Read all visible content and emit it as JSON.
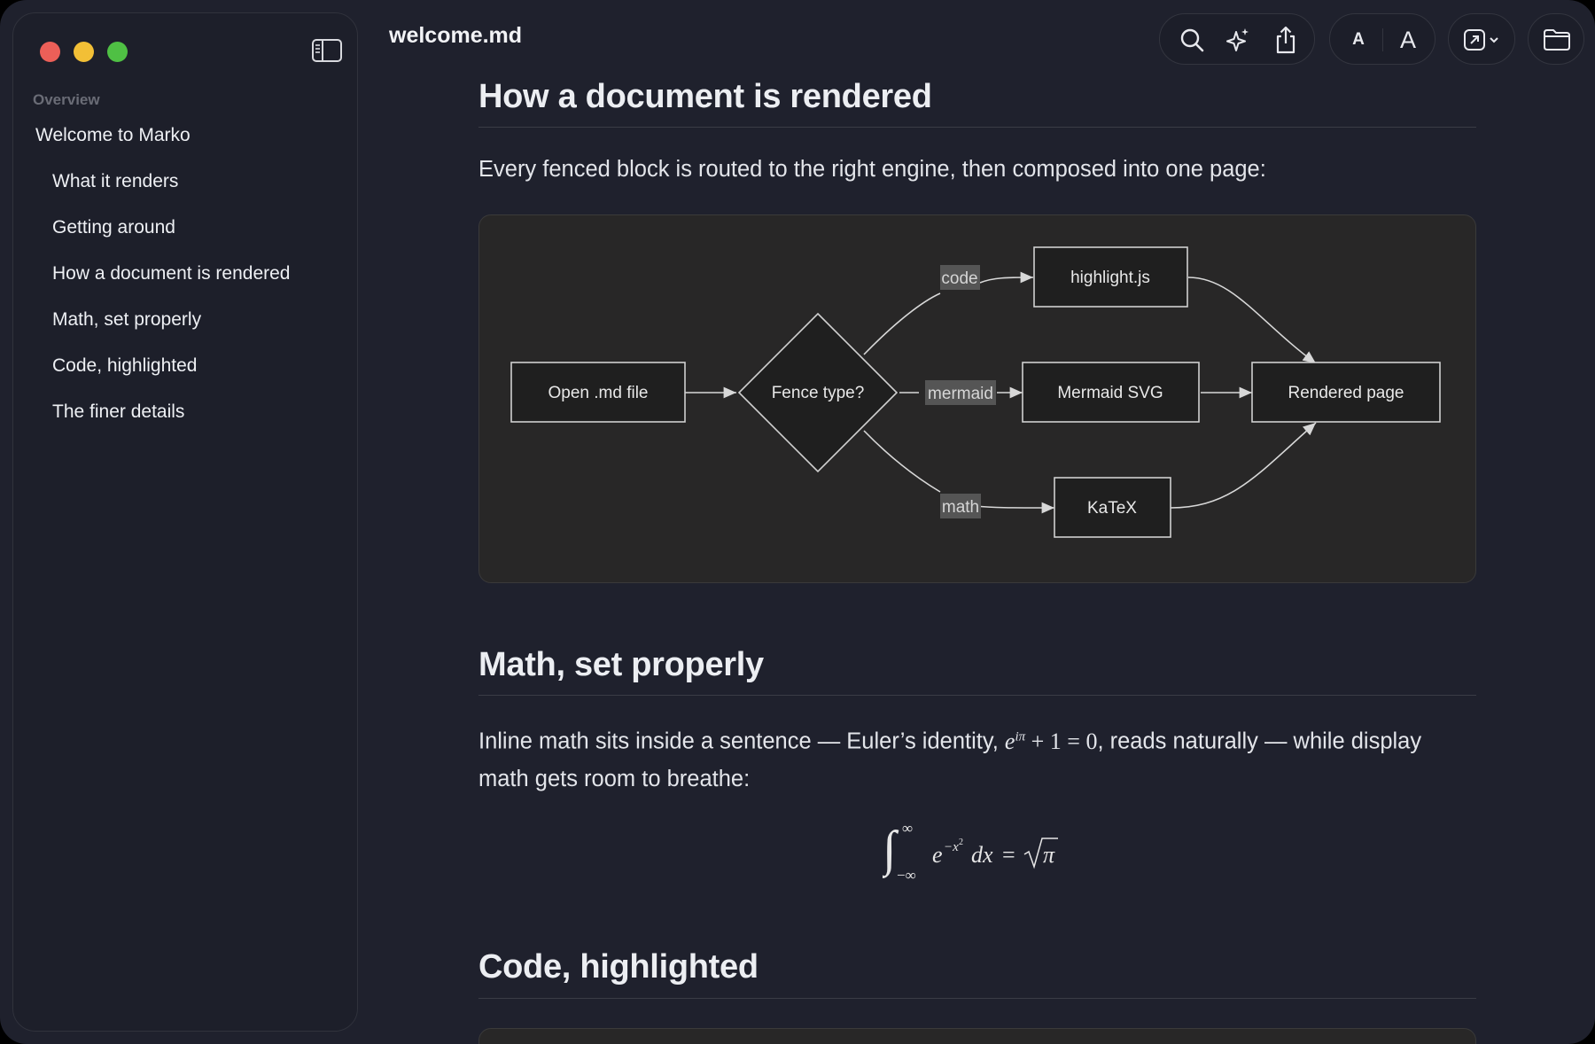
{
  "window": {
    "file_name": "welcome.md"
  },
  "sidebar": {
    "section_label": "Overview",
    "items": [
      {
        "label": "Welcome to Marko",
        "level": 1
      },
      {
        "label": "What it renders",
        "level": 2
      },
      {
        "label": "Getting around",
        "level": 2
      },
      {
        "label": "How a document is rendered",
        "level": 2
      },
      {
        "label": "Math, set properly",
        "level": 2
      },
      {
        "label": "Code, highlighted",
        "level": 2
      },
      {
        "label": "The finer details",
        "level": 2
      }
    ]
  },
  "toolbar": {
    "icons": [
      "search-icon",
      "sparkle-icon",
      "share-icon",
      "font-smaller-icon",
      "font-larger-icon",
      "open-external-icon",
      "folder-icon"
    ],
    "font_small_label": "A",
    "font_large_label": "A"
  },
  "sections": {
    "rendering": {
      "heading": "How a document is rendered",
      "intro": "Every fenced block is routed to the right engine, then composed into one page:"
    },
    "math": {
      "heading": "Math, set properly",
      "para_before": "Inline math sits inside a sentence — Euler’s identity, ",
      "para_after": ", reads naturally — while display math gets room to breathe:"
    },
    "code": {
      "heading": "Code, highlighted"
    }
  },
  "flowchart": {
    "nodes": {
      "open": "Open .md file",
      "fence": "Fence type?",
      "highlight": "highlight.js",
      "mermaid": "Mermaid SVG",
      "katex": "KaTeX",
      "rendered": "Rendered page"
    },
    "edge_labels": {
      "code": "code",
      "mermaid": "mermaid",
      "math": "math"
    }
  },
  "colors": {
    "background": "#1f212d",
    "sidebar": "#1d1f2a",
    "diagram_bg": "#282727",
    "close": "#ec5f58",
    "minimize": "#f2bf36",
    "zoom": "#4fc044"
  }
}
